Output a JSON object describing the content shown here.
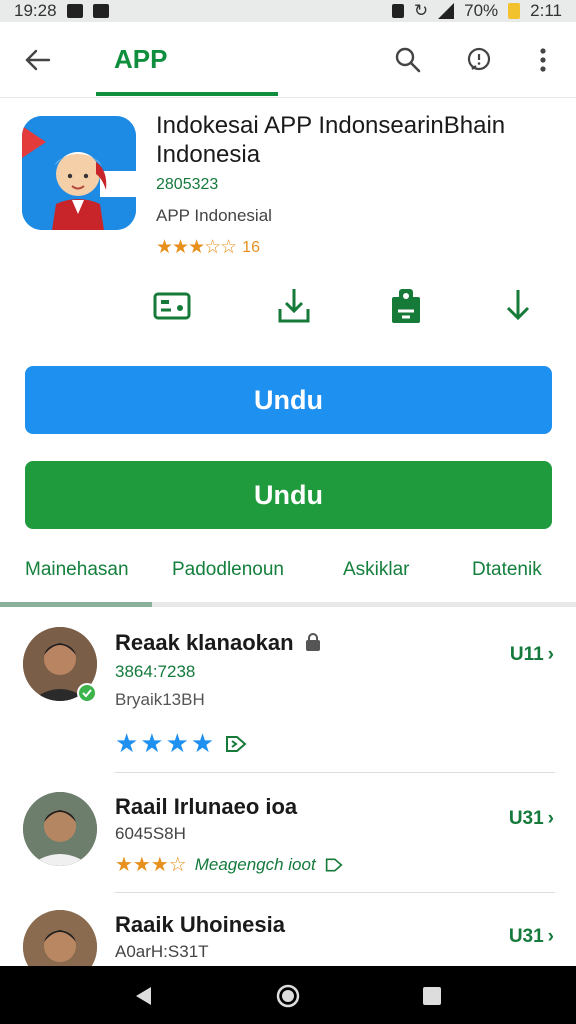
{
  "status_bar": {
    "time": "19:28",
    "battery": "70%",
    "clock": "2:11"
  },
  "header": {
    "title": "APP"
  },
  "app": {
    "name": "Indokesai APP IndonsearinBhain Indonesia",
    "id": "2805323",
    "developer": "APP Indonesial",
    "stars": "★★★☆☆",
    "rating_count": "16"
  },
  "buttons": {
    "primary": "Undu",
    "secondary": "Undu"
  },
  "tabs": [
    {
      "label": "Mainehasan"
    },
    {
      "label": "Padodlenoun"
    },
    {
      "label": "Askiklar"
    },
    {
      "label": "Dtatenik"
    }
  ],
  "reviews": [
    {
      "name": "Reaak klanaokan",
      "sub1": "3864:7238",
      "sub2": "Bryaik13BH",
      "stars": "★★★★",
      "meta": "U11"
    },
    {
      "name": "Raail Irlunaeo ioa",
      "sub1": "6045S8H",
      "stars": "★★★☆",
      "stars_note": "Meagengch ioot",
      "meta": "U31"
    },
    {
      "name": "Raaik Uhoinesia",
      "sub1": "A0arH:S31T",
      "meta": "U31"
    }
  ],
  "colors": {
    "primary_green": "#1f9b3e",
    "primary_blue": "#1e90f0",
    "star_orange": "#e8901d",
    "star_blue": "#1e90f0"
  }
}
